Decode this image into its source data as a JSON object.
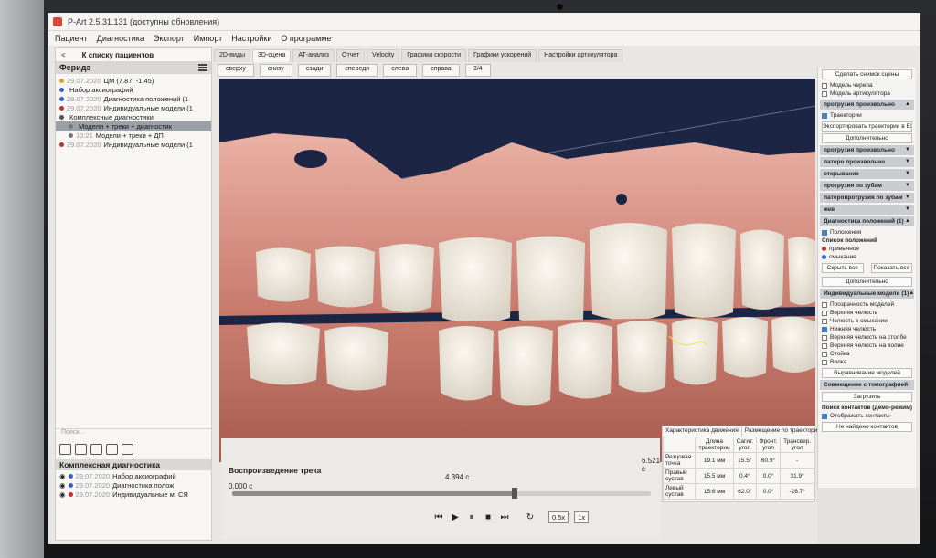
{
  "window": {
    "title": "P-Art 2.5.31.131 (доступны обновления)"
  },
  "menu": [
    "Пациент",
    "Диагностика",
    "Экспорт",
    "Импорт",
    "Настройки",
    "О программе"
  ],
  "left_panel": {
    "back_label": "<",
    "back_to_list": "К списку пациентов",
    "patient_name": "Феридэ",
    "tree": [
      {
        "date": "29.07.2020",
        "text": "ЦМ (7.87, -1.45)",
        "dot": "#e0a020",
        "selected": false
      },
      {
        "date": "",
        "text": "Набор аксиографий",
        "dot": "#3a5fc8",
        "selected": false
      },
      {
        "date": "29.07.2020",
        "text": "Диагностика положений (1",
        "dot": "#3a5fc8",
        "selected": false
      },
      {
        "date": "29.07.2020",
        "text": "Индивидуальные модели (1",
        "dot": "#c03030",
        "selected": false
      },
      {
        "date": "",
        "text": "Комплексные диагностики",
        "dot": "#555555",
        "selected": false
      },
      {
        "date": "",
        "text": "Модели + треки + диагностик",
        "dot": "#777777",
        "selected": true
      },
      {
        "date": "10:21",
        "text": "Модели + треки + ДП",
        "dot": "#777777",
        "selected": false
      },
      {
        "date": "29.07.2020",
        "text": "Индивидуальные модели (1",
        "dot": "#c03030",
        "selected": false
      }
    ],
    "search_placeholder": "Поиск...",
    "complex_header": "Комплексная диагностика",
    "complex_items": [
      {
        "date": "29.07.2020",
        "text": "Набор аксиографий",
        "dot": "#3a5fc8"
      },
      {
        "date": "29.07.2020",
        "text": "Диагностика полож",
        "dot": "#3a5fc8"
      },
      {
        "date": "29.07.2020",
        "text": "Индивидуальные м. СЯ",
        "dot": "#c03030"
      }
    ]
  },
  "tabs": [
    "2D-виды",
    "3D-сцена",
    "АТ-анализ",
    "Отчет",
    "Velocity",
    "Графики скорости",
    "Графики ускорений",
    "Настройки артикулятора"
  ],
  "view_buttons": [
    "сверху",
    "снизу",
    "сзади",
    "спереди",
    "слева",
    "справа",
    "3/4"
  ],
  "playback": {
    "label": "Воспроизведение трека",
    "start": "0.000 с",
    "current": "4.394 с",
    "end": "6.521 с",
    "progress": 0.674,
    "speeds": [
      "0.5x",
      "1x"
    ]
  },
  "stats": {
    "tabs": [
      "Характеристика движения",
      "Размещение по траектории"
    ],
    "columns": [
      "",
      "Длина траектории",
      "Сагит. угол",
      "Фронт. угол",
      "Трансвер. угол"
    ],
    "rows": [
      [
        "Резцовая точка",
        "19.1 мм",
        "15.5°",
        "60.9°",
        "-"
      ],
      [
        "Правый сустав",
        "15.5 мм",
        "0.4°",
        "0.0°",
        "31.9°"
      ],
      [
        "Левый сустав",
        "15.6 мм",
        "62.0°",
        "0.0°",
        "-28.7°"
      ]
    ]
  },
  "right_panel": {
    "top_button": "Сделать снимок сцены",
    "checks_top": [
      {
        "label": "Модель черепа",
        "on": false
      },
      {
        "label": "Модель артикулятора",
        "on": false
      }
    ],
    "section_main": "протрузия произвольно",
    "traj_check": "Траектории",
    "export_button": "Экспортировать траектории в Excel",
    "more_button": "Дополнительно",
    "sections": [
      "протрузия произвольно",
      "латеро произвольно",
      "открывание",
      "протрузия по зубам",
      "латеропротрузия по зубам",
      "жев"
    ],
    "diag_section": "Диагностика положений (1)",
    "pos_check": "Положения",
    "pos_list_title": "Список положений",
    "pos_list": [
      {
        "label": "привычное",
        "color": "#c03030"
      },
      {
        "label": "смыкание",
        "color": "#3a5fc8"
      }
    ],
    "hide_all": "Скрыть все",
    "show_all": "Показать все",
    "more_button2": "Дополнительно",
    "models_section": "Индивидуальные модели (1)",
    "model_checks": [
      {
        "label": "Прозрачность моделей",
        "on": false
      },
      {
        "label": "Верхняя челюсть",
        "on": false
      },
      {
        "label": "Челюсть в смыкании",
        "on": false
      },
      {
        "label": "Нижняя челюсть",
        "on": true
      },
      {
        "label": "Верхняя челюсть на столбе",
        "on": false
      },
      {
        "label": "Верхняя челюсть на волне",
        "on": false
      },
      {
        "label": "Стойка",
        "on": false
      },
      {
        "label": "Вилка",
        "on": false
      }
    ],
    "combine_button": "Выравнивание моделей",
    "tomography": "Совмещение с томографией",
    "load": "Загрузить",
    "contacts_title": "Поиск контактов (демо-режим)",
    "contacts_check": "Отображать контакты",
    "no_contacts": "Не найдено контактов"
  }
}
